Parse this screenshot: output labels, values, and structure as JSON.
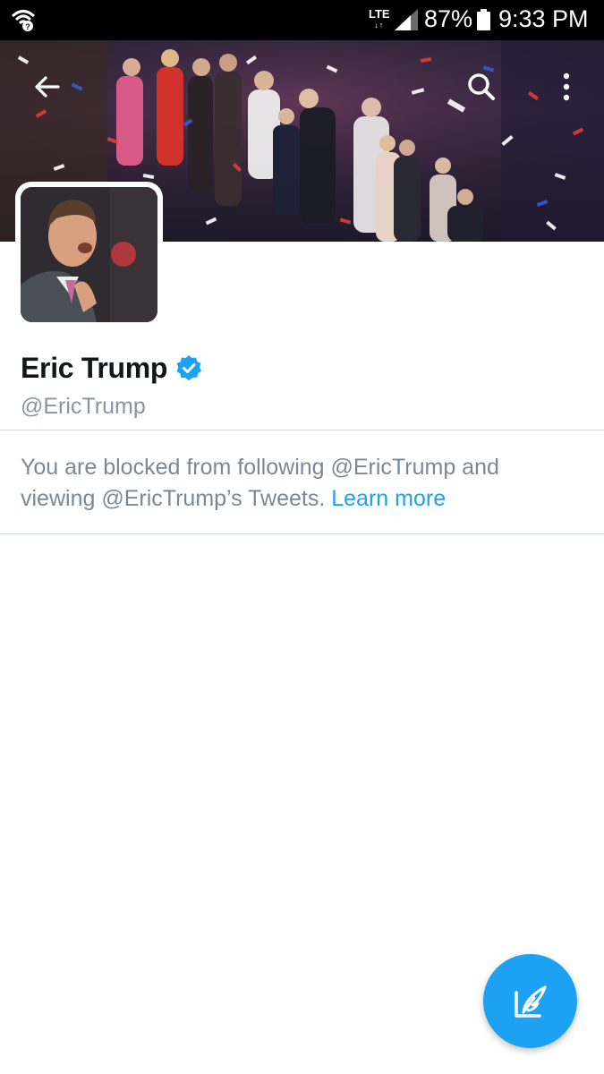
{
  "status_bar": {
    "network": "LTE",
    "battery_percent": "87%",
    "time": "9:33 PM",
    "icons": [
      "wifi-icon",
      "signal-icon",
      "battery-icon"
    ]
  },
  "header": {
    "back_icon": "arrow-left-icon",
    "search_icon": "search-icon",
    "more_icon": "more-vertical-icon"
  },
  "profile": {
    "display_name": "Eric Trump",
    "verified": true,
    "handle": "@EricTrump"
  },
  "blocked_notice": {
    "text": "You are blocked from following @EricTrump and viewing @EricTrump’s Tweets.",
    "link_label": "Learn more"
  },
  "fab": {
    "icon": "compose-tweet-icon"
  },
  "colors": {
    "accent": "#1da1f2",
    "name_text": "#14171a",
    "secondary_text": "#8a949e",
    "divider": "#d4dade"
  }
}
